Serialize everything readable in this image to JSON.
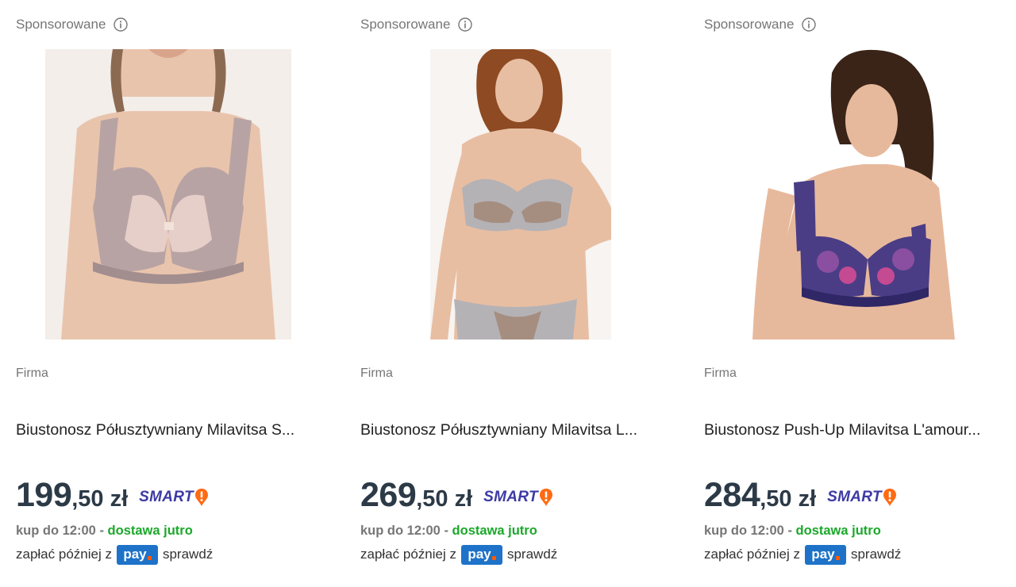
{
  "products": [
    {
      "sponsored_label": "Sponsorowane",
      "info_icon": "info-circle-icon",
      "image_alt": "Biustonosz Półusztywniany Milavitsa",
      "image_colors": {
        "bg": "#f3eeea",
        "skin": "#e9c4ac",
        "bra": "#b8a3a4",
        "hair": "#8c6a52"
      },
      "brand": "Firma",
      "title": "Biustonosz Półusztywniany Milavitsa S...",
      "price_int": "199",
      "price_dec": ",50",
      "currency": "zł",
      "smart_label": "SMART",
      "delivery_prefix": "kup do 12:00 -",
      "delivery_highlight": "dostawa jutro",
      "pay_prefix": "zapłać później z",
      "pay_logo": "pay",
      "pay_check": "sprawdź"
    },
    {
      "sponsored_label": "Sponsorowane",
      "info_icon": "info-circle-icon",
      "image_alt": "Biustonosz Półusztywniany Milavitsa",
      "image_colors": {
        "bg": "#f7f4f2",
        "skin": "#e8bea2",
        "bra": "#b5b2b6",
        "hair": "#8e4a22"
      },
      "brand": "Firma",
      "title": "Biustonosz Półusztywniany Milavitsa L...",
      "price_int": "269",
      "price_dec": ",50",
      "currency": "zł",
      "smart_label": "SMART",
      "delivery_prefix": "kup do 12:00 -",
      "delivery_highlight": "dostawa jutro",
      "pay_prefix": "zapłać później z",
      "pay_logo": "pay",
      "pay_check": "sprawdź"
    },
    {
      "sponsored_label": "Sponsorowane",
      "info_icon": "info-circle-icon",
      "image_alt": "Biustonosz Push-Up Milavitsa L'amour",
      "image_colors": {
        "bg": "#ffffff",
        "skin": "#e7b99c",
        "bra": "#4a3d86",
        "hair": "#3a2418"
      },
      "brand": "Firma",
      "title": "Biustonosz Push-Up Milavitsa L'amour...",
      "price_int": "284",
      "price_dec": ",50",
      "currency": "zł",
      "smart_label": "SMART",
      "delivery_prefix": "kup do 12:00 -",
      "delivery_highlight": "dostawa jutro",
      "pay_prefix": "zapłać później z",
      "pay_logo": "pay",
      "pay_check": "sprawdź"
    }
  ],
  "colors": {
    "label_gray": "#767676",
    "price": "#2c3a47",
    "smart": "#3d3aa3",
    "smart_badge": "#ff6a13",
    "delivery_green": "#1ba82a",
    "pay_blue": "#1e73c9",
    "pay_dot": "#ff5a00"
  }
}
